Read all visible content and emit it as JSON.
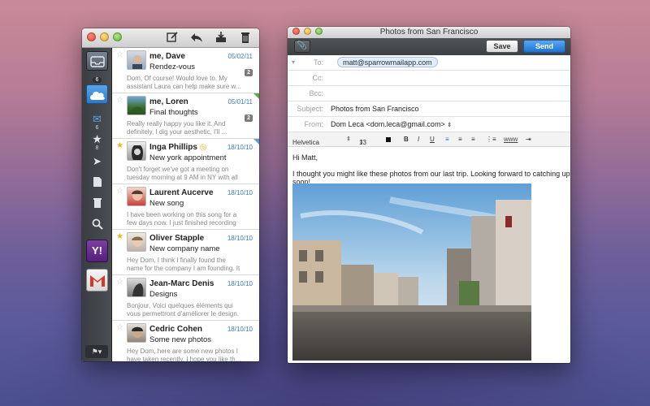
{
  "main_window": {
    "toolbar_icons": [
      "compose-icon",
      "reply-icon",
      "archive-icon",
      "trash-icon"
    ],
    "sidebar": {
      "inbox_badge": "6",
      "unread_count": "6",
      "starred_count": "8"
    },
    "messages": [
      {
        "sender": "me, Dave",
        "date": "05/02/11",
        "subject": "Rendez-vous",
        "preview": "Dom, Of course! Would love to. My assistant Laura can help make sure w...",
        "count": "2",
        "starred": false
      },
      {
        "sender": "me, Loren",
        "date": "05/01/11",
        "subject": "Final thoughts",
        "preview": "Really really happy you like it. And definitely, I dig your aesthetic, I'll ...",
        "count": "2",
        "starred": false
      },
      {
        "sender": "Inga Phillips",
        "date": "18/10/10",
        "subject": "New york appointment",
        "preview": "Don't forget we've got a meeting on tuesday morning at 9 AM in NY with all the investor...",
        "count": "",
        "starred": true
      },
      {
        "sender": "Laurent Aucerve",
        "date": "18/10/10",
        "subject": "New song",
        "preview": "I have been working on this song for a few days now. I just finished recording it...",
        "count": "",
        "starred": false
      },
      {
        "sender": "Oliver Stapple",
        "date": "18/10/10",
        "subject": "New company name",
        "preview": "Hey Dom, I think I finally found the name for the company I am founding. It will be calle...",
        "count": "",
        "starred": true
      },
      {
        "sender": "Jean-Marc Denis",
        "date": "18/10/10",
        "subject": "Designs",
        "preview": "Bonjour, Voici quelques éléments qui vous permettront d'améliorer le design. Vous...",
        "count": "",
        "starred": false
      },
      {
        "sender": "Cedric Cohen",
        "date": "18/10/10",
        "subject": "Some new photos",
        "preview": "Hey Dom, here are some new photos I have taken recently. I hope you like th...",
        "count": "",
        "starred": false
      }
    ]
  },
  "compose_window": {
    "title": "Photos from San Francisco",
    "save_label": "Save",
    "send_label": "Send",
    "to_label": "To:",
    "to_value": "matt@sparrowmailapp.com",
    "cc_label": "Cc:",
    "bcc_label": "Bcc:",
    "subject_label": "Subject:",
    "subject_value": "Photos from San Francisco",
    "from_label": "From:",
    "from_value": "Dom Leca <dom.leca@gmail.com>",
    "font_name": "Helvetica",
    "font_size": "13",
    "bold": "B",
    "italic": "I",
    "underline": "U",
    "link": "www",
    "greeting": "Hi Matt,",
    "body": "I thought you might like these photos from our last trip. Looking forward to catching up soon!"
  }
}
